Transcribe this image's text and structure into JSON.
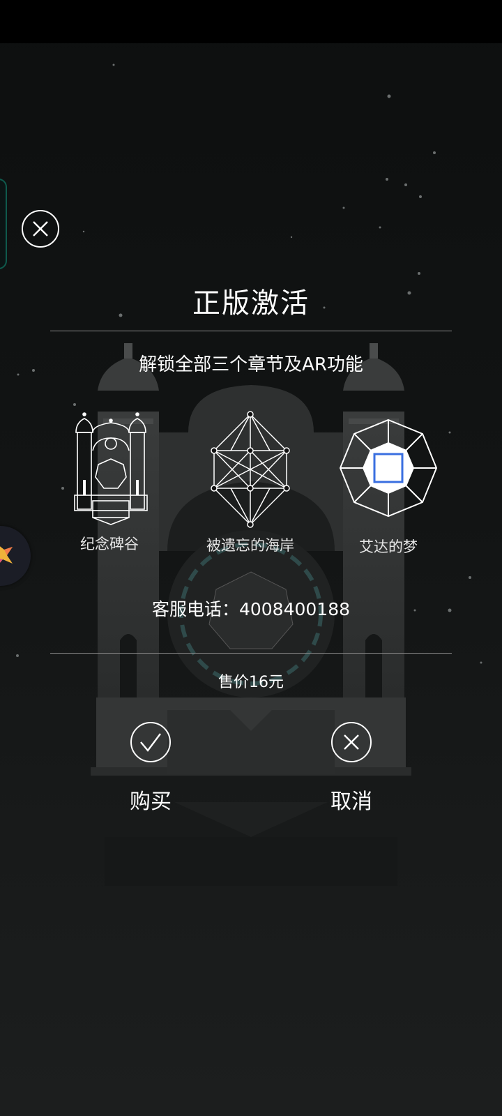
{
  "dialog": {
    "title": "正版激活",
    "subtitle": "解锁全部三个章节及AR功能",
    "chapters": [
      {
        "name": "纪念碑谷",
        "icon": "temple-icon"
      },
      {
        "name": "被遗忘的海岸",
        "icon": "crystal-icon"
      },
      {
        "name": "艾达的梦",
        "icon": "octagon-icon"
      }
    ],
    "service_phone": "客服电话：4008400188",
    "price": "售价16元",
    "buy_label": "购买",
    "cancel_label": "取消"
  },
  "colors": {
    "background": "#111313",
    "accent_blue": "#3a6fe0",
    "side_tab_border": "#0f5a4d"
  }
}
